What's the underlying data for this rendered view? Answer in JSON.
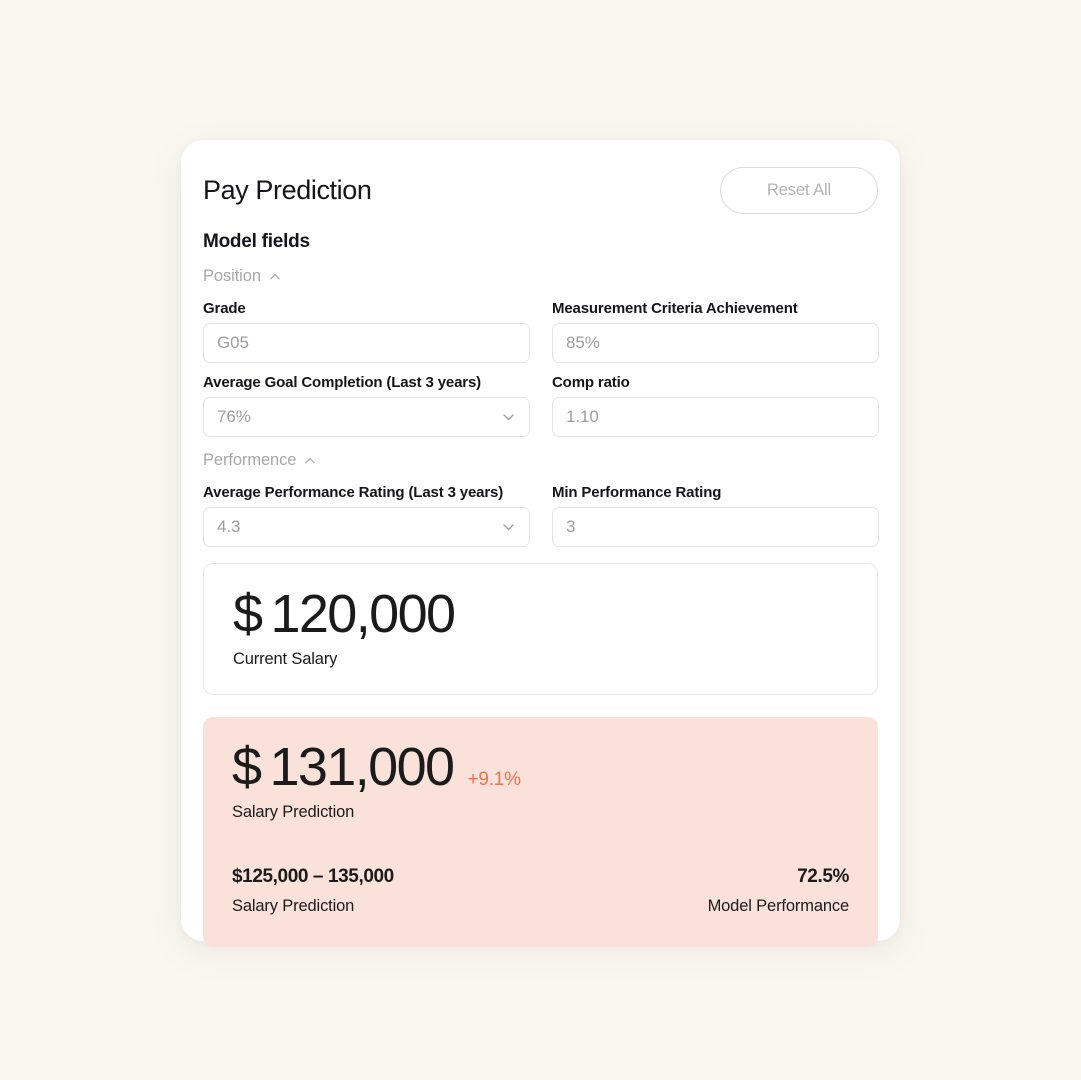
{
  "header": {
    "title": "Pay Prediction",
    "reset_label": "Reset All"
  },
  "model_fields": {
    "section_title": "Model fields",
    "groups": [
      {
        "label": "Position",
        "chevron": "chevron-up-icon",
        "fields": [
          {
            "label": "Grade",
            "value": "G05",
            "type": "text"
          },
          {
            "label": "Measurement Criteria Achievement",
            "value": "85%",
            "type": "text"
          },
          {
            "label": "Average Goal Completion  (Last 3 years)",
            "value": "76%",
            "type": "select"
          },
          {
            "label": "Comp ratio",
            "value": "1.10",
            "type": "text"
          }
        ]
      },
      {
        "label": "Performence",
        "chevron": "chevron-up-icon",
        "fields": [
          {
            "label": "Average Performance Rating  (Last 3 years)",
            "value": "4.3",
            "type": "select"
          },
          {
            "label": "Min Performance Rating",
            "value": "3",
            "type": "text"
          }
        ]
      }
    ]
  },
  "current_salary": {
    "currency": "$",
    "amount": "120,000",
    "caption": "Current Salary"
  },
  "prediction": {
    "currency": "$",
    "amount": "131,000",
    "delta": "+9.1%",
    "caption": "Salary Prediction",
    "range_value": "$125,000 – 135,000",
    "range_caption": "Salary Prediction",
    "performance_value": "72.5%",
    "performance_caption": "Model Performance"
  },
  "colors": {
    "page_background": "#FAF7F1",
    "card_background": "#FFFFFF",
    "prediction_background": "#FAE2DB",
    "accent": "#EE7250",
    "text_primary": "#1B1B1B",
    "text_muted": "#A7A7A7",
    "border": "#E4E4E4"
  }
}
